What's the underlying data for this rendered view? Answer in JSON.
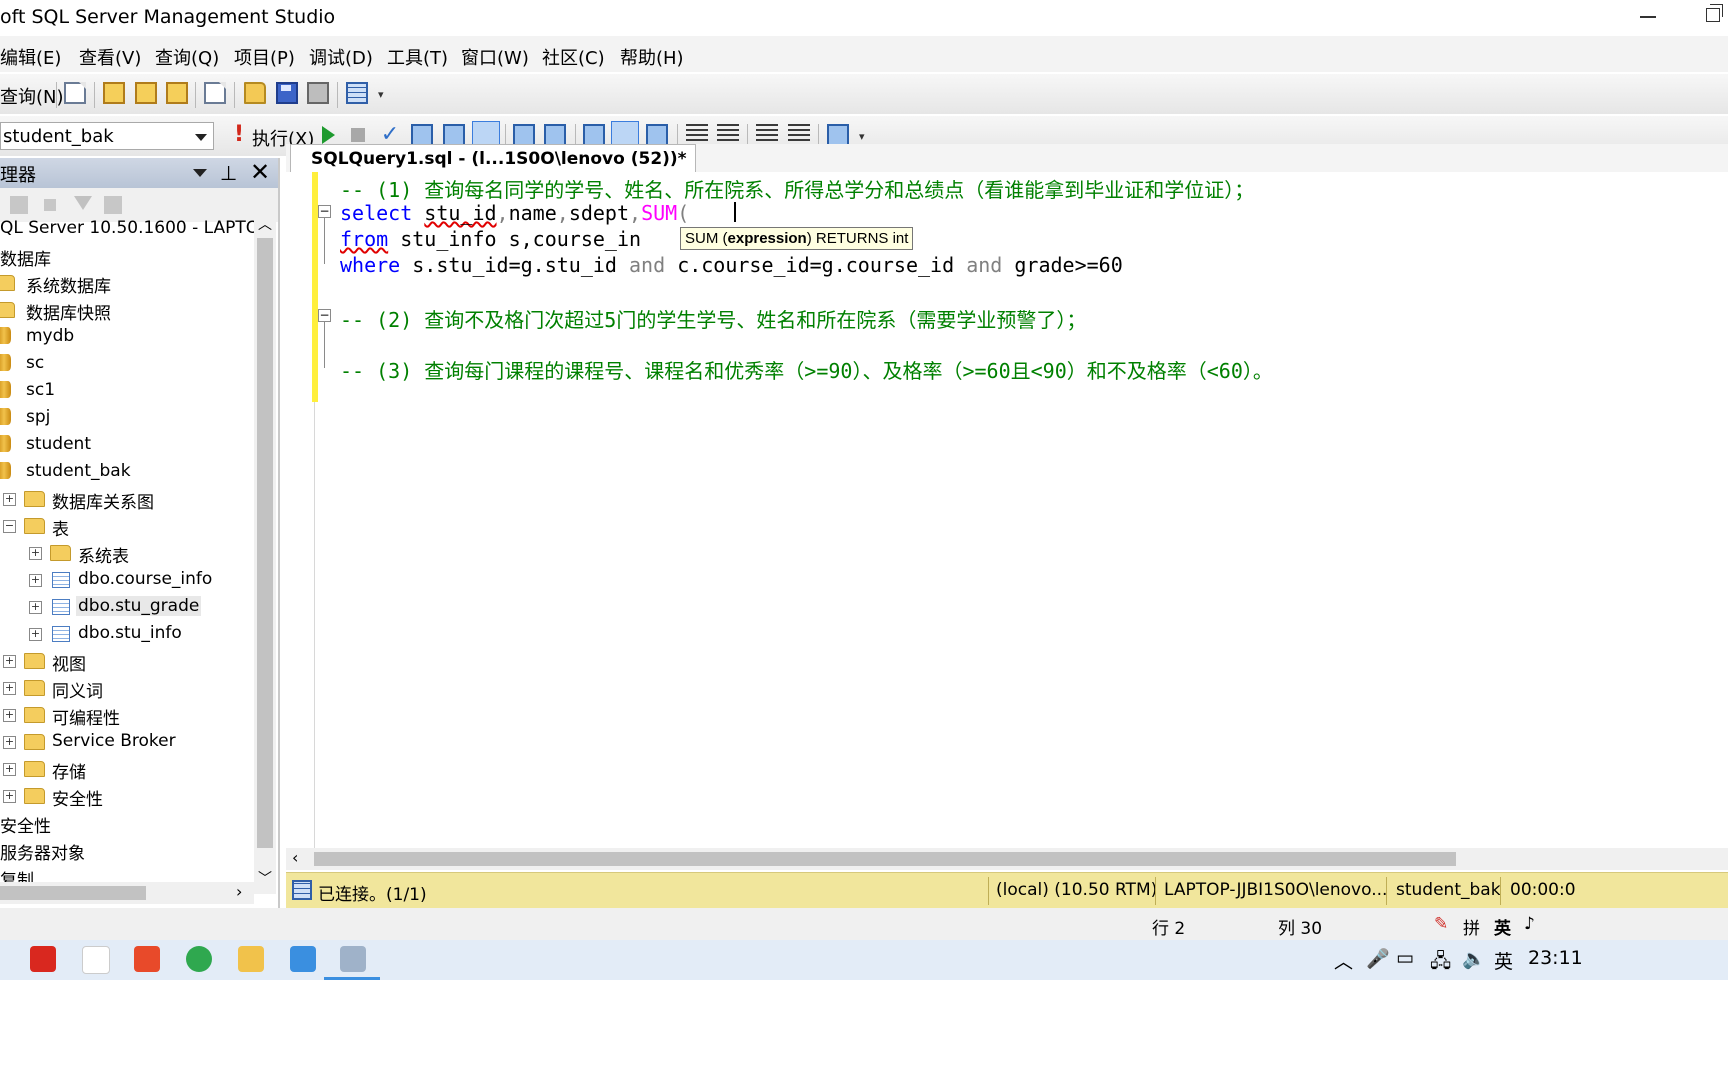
{
  "window": {
    "title": "oft SQL Server Management Studio"
  },
  "menu": [
    {
      "label": "编辑(E)"
    },
    {
      "label": "查看(V)"
    },
    {
      "label": "查询(Q)"
    },
    {
      "label": "项目(P)"
    },
    {
      "label": "调试(D)"
    },
    {
      "label": "工具(T)"
    },
    {
      "label": "窗口(W)"
    },
    {
      "label": "社区(C)"
    },
    {
      "label": "帮助(H)"
    }
  ],
  "toolbar1": {
    "new_query_label": "查询(N)"
  },
  "toolbar2": {
    "database": "student_bak",
    "execute_label": "执行(X)"
  },
  "explorer": {
    "title": "理器",
    "server": "QL Server 10.50.1600 - LAPTOP-",
    "nodes": [
      {
        "label": "数据库"
      },
      {
        "label": "系统数据库"
      },
      {
        "label": "数据库快照"
      },
      {
        "label": "mydb"
      },
      {
        "label": "sc"
      },
      {
        "label": "sc1"
      },
      {
        "label": "spj"
      },
      {
        "label": "student"
      },
      {
        "label": "student_bak"
      },
      {
        "label": "数据库关系图"
      },
      {
        "label": "表"
      },
      {
        "label": "系统表"
      },
      {
        "label": "dbo.course_info"
      },
      {
        "label": "dbo.stu_grade"
      },
      {
        "label": "dbo.stu_info"
      },
      {
        "label": "视图"
      },
      {
        "label": "同义词"
      },
      {
        "label": "可编程性"
      },
      {
        "label": "Service Broker"
      },
      {
        "label": "存储"
      },
      {
        "label": "安全性"
      },
      {
        "label": "安全性"
      },
      {
        "label": "服务器对象"
      },
      {
        "label": "复制"
      }
    ]
  },
  "editor": {
    "tab": "SQLQuery1.sql - (l...1S0O\\lenovo (52))*",
    "lines": {
      "l1": "-- (1) 查询每名同学的学号、姓名、所在院系、所得总学分和总绩点（看谁能拿到毕业证和学位证）；",
      "l2_kw": "select",
      "l2_a": "stu_id",
      "l2_b": "name",
      "l2_c": "sdept",
      "l2_fn": "SUM",
      "l3_kw": "from",
      "l3_text": "stu_info s,course_in",
      "l4_kw": "where",
      "l4_a": "s.stu_id=g.stu_id",
      "l4_and1": "and",
      "l4_b": "c.course_id=g.course_id",
      "l4_and2": "and",
      "l4_c": "grade>=60",
      "l5": "-- (2) 查询不及格门次超过5门的学生学号、姓名和所在院系（需要学业预警了）；",
      "l6": "-- (3) 查询每门课程的课程号、课程名和优秀率（>=90）、及格率（>=60且<90）和不及格率（<60）。"
    },
    "tooltip": {
      "func": "SUM",
      "param": "expression",
      "returns": "RETURNS int"
    }
  },
  "query_status": {
    "connected": "已连接。(1/1)",
    "server": "(local) (10.50 RTM)",
    "login": "LAPTOP-JJBI1S0O\\lenovo...",
    "database": "student_bak",
    "time": "00:00:0"
  },
  "statusbar": {
    "row": "行 2",
    "col": "列 30"
  },
  "taskbar": {
    "ime": "英",
    "ime_tray": "英",
    "ime_pinyin": "拼",
    "clock": "23:11"
  }
}
